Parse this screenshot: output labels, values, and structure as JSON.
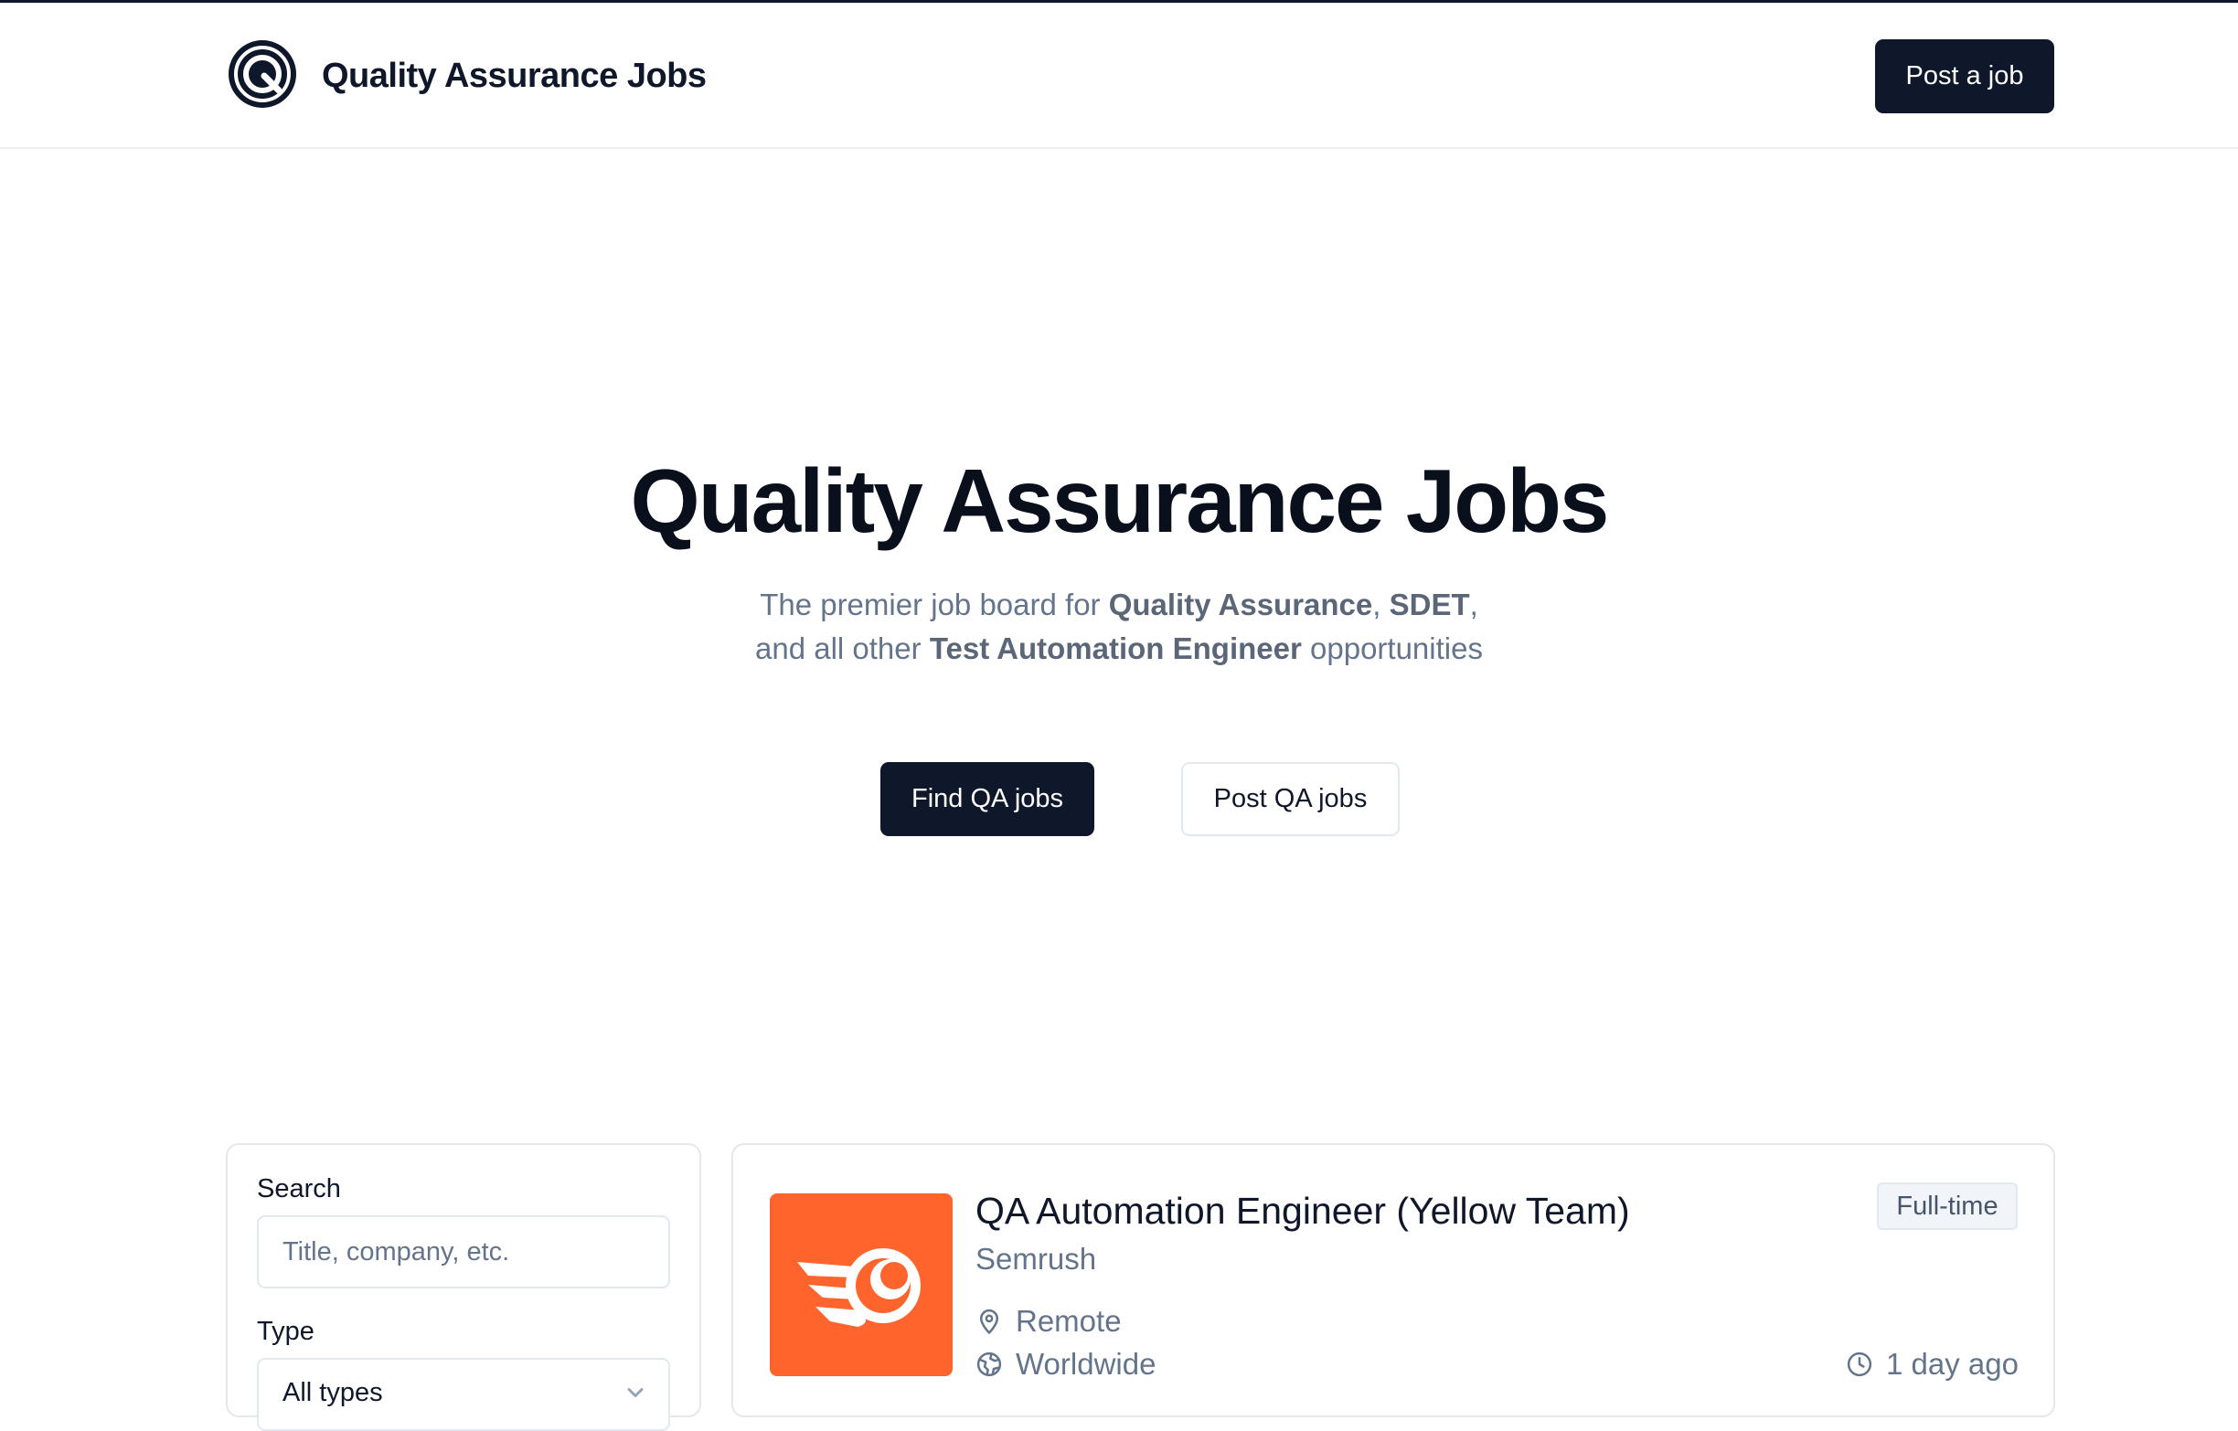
{
  "header": {
    "brand": "Quality Assurance Jobs",
    "post_job_label": "Post a job"
  },
  "hero": {
    "title": "Quality Assurance Jobs",
    "sub_line1_pre": "The premier job board for ",
    "sub_line1_b1": "Quality Assurance",
    "sub_line1_mid": ", ",
    "sub_line1_b2": "SDET",
    "sub_line1_post": ",",
    "sub_line2_pre": "and all other ",
    "sub_line2_b": "Test Automation Engineer",
    "sub_line2_post": " opportunities",
    "find_label": "Find QA jobs",
    "post_label": "Post QA jobs"
  },
  "filters": {
    "search_label": "Search",
    "search_placeholder": "Title, company, etc.",
    "type_label": "Type",
    "type_value": "All types"
  },
  "jobs": [
    {
      "title": "QA Automation Engineer (Yellow Team)",
      "company": "Semrush",
      "location": "Remote",
      "region": "Worldwide",
      "type": "Full-time",
      "posted": "1 day ago",
      "logo_color": "#ff642d"
    }
  ],
  "colors": {
    "primary": "#0f172a",
    "muted": "#64748b",
    "border": "#e2e8f0"
  }
}
